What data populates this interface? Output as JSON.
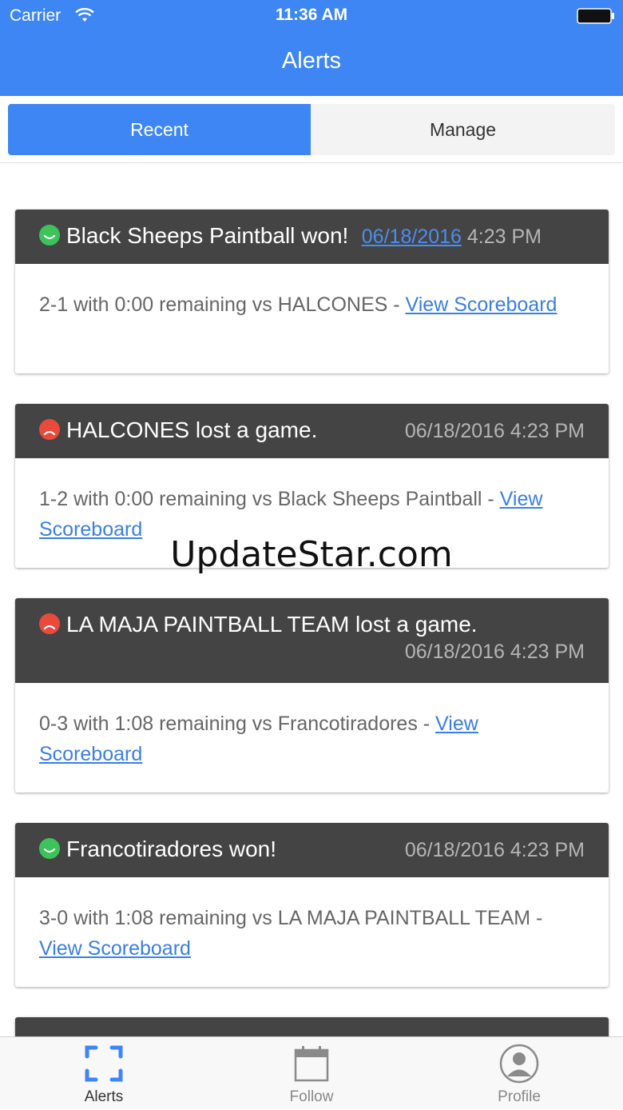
{
  "status_bar": {
    "carrier": "Carrier",
    "time": "11:36 AM"
  },
  "nav": {
    "title": "Alerts"
  },
  "segments": {
    "recent": "Recent",
    "manage": "Manage"
  },
  "colors": {
    "brand_blue": "#3d86f4",
    "header_dark": "#444444",
    "won_green": "#3cc45a",
    "lost_red": "#ea4a3b"
  },
  "alerts": [
    {
      "icon": "happy-face-icon",
      "title": "Black Sheeps Paintball won!",
      "date": "06/18/2016",
      "time": "4:23 PM",
      "body": "2-1 with 0:00 remaining vs HALCONES - ",
      "link": "View Scoreboard"
    },
    {
      "icon": "sad-face-icon",
      "title": "HALCONES lost a game.",
      "date": "06/18/2016",
      "time": "4:23 PM",
      "body": "1-2 with 0:00 remaining vs Black Sheeps Paintball - ",
      "link": "View Scoreboard"
    },
    {
      "icon": "sad-face-icon",
      "title": "LA MAJA PAINTBALL TEAM lost a game.",
      "date": "06/18/2016",
      "time": "4:23 PM",
      "body": "0-3 with 1:08 remaining vs Francotiradores - ",
      "link": "View Scoreboard"
    },
    {
      "icon": "happy-face-icon",
      "title": "Francotiradores won!",
      "date": "06/18/2016",
      "time": "4:23 PM",
      "body": "3-0 with 1:08 remaining vs LA MAJA PAINTBALL TEAM - ",
      "link": "View Scoreboard"
    }
  ],
  "watermark": "UpdateStar.com",
  "tabs": {
    "alerts": "Alerts",
    "follow": "Follow",
    "profile": "Profile"
  }
}
